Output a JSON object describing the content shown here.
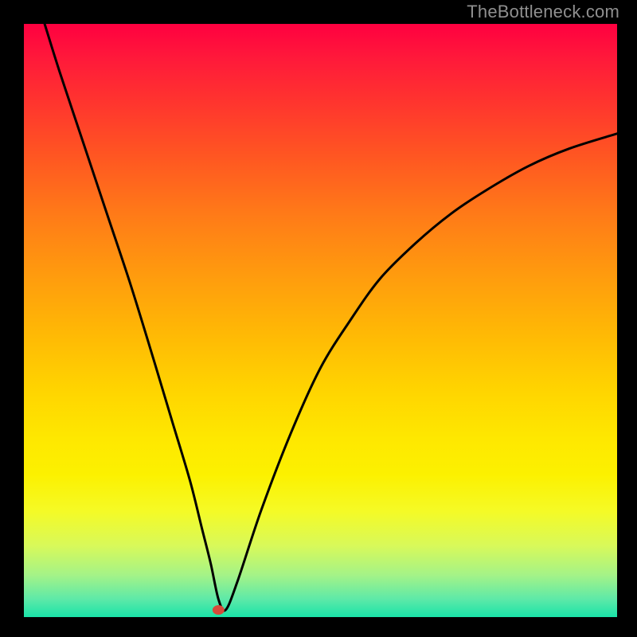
{
  "watermark": "TheBottleneck.com",
  "chart_data": {
    "type": "line",
    "title": "",
    "xlabel": "",
    "ylabel": "",
    "xlim": [
      0,
      100
    ],
    "ylim": [
      0,
      100
    ],
    "series": [
      {
        "name": "bottleneck-curve",
        "x": [
          3.5,
          6,
          10,
          14,
          18,
          22,
          25,
          28,
          30,
          31.5,
          32.8,
          34,
          36,
          40,
          45,
          50,
          55,
          60,
          66,
          72,
          78,
          85,
          92,
          100
        ],
        "y": [
          100,
          92,
          80,
          68,
          56,
          43,
          33,
          23,
          15,
          9,
          3,
          1.2,
          6,
          18,
          31,
          42,
          50,
          57,
          63,
          68,
          72,
          76,
          79,
          81.5
        ]
      }
    ],
    "marker": {
      "x": 32.8,
      "y": 1.2
    },
    "background_gradient": {
      "top": "#ff0040",
      "bottom": "#19e3a8"
    }
  }
}
